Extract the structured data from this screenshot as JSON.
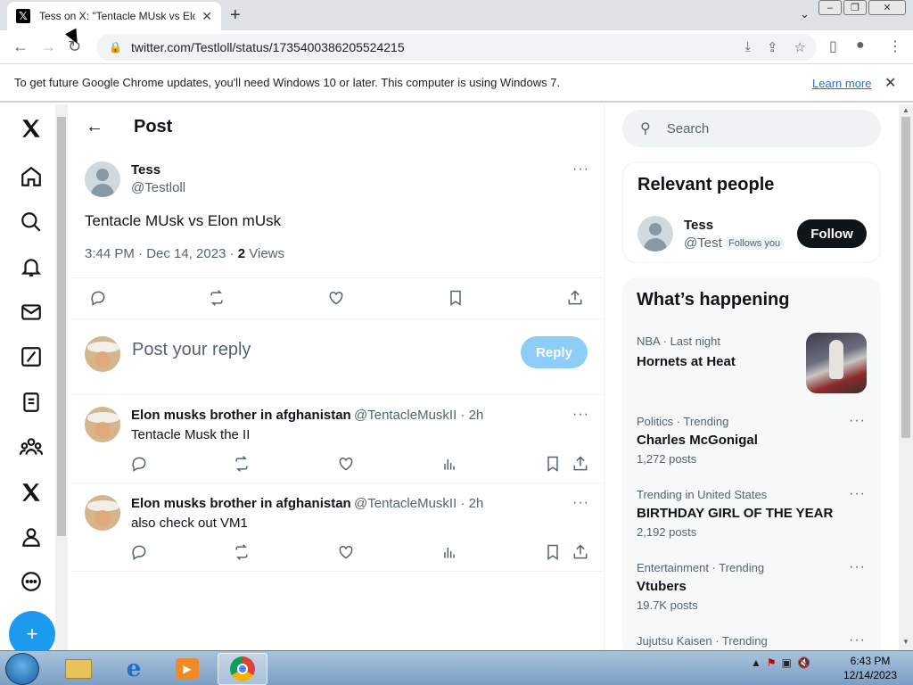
{
  "browser": {
    "tab_title": "Tess on X: \"Tentacle MUsk vs Elon",
    "url": "twitter.com/Testloll/status/1735400386205524215",
    "infobar_text": "To get future Google Chrome updates, you'll need Windows 10 or later. This computer is using Windows 7.",
    "infobar_link": "Learn more"
  },
  "header": {
    "title": "Post"
  },
  "tweet": {
    "name": "Tess",
    "handle": "@Testloll",
    "text": "Tentacle MUsk vs Elon mUsk",
    "time": "3:44 PM · Dec 14, 2023 · ",
    "views_count": "2",
    "views_label": " Views"
  },
  "reply_box": {
    "placeholder": "Post your reply",
    "button": "Reply"
  },
  "replies": [
    {
      "name": "Elon musks brother in afghanistan",
      "handle": "@TentacleMuskII · 2h",
      "text": "Tentacle Musk the II"
    },
    {
      "name": "Elon musks brother in afghanistan",
      "handle": "@TentacleMuskII · 2h",
      "text": "also check out VM1"
    }
  ],
  "search": {
    "placeholder": "Search"
  },
  "relevant": {
    "heading": "Relevant people",
    "name": "Tess",
    "handle": "@Test",
    "follows_you": "Follows you",
    "follow_btn": "Follow"
  },
  "happening": {
    "heading": "What’s happening",
    "trends": [
      {
        "category": "NBA · Last night",
        "title": "Hornets at Heat",
        "count": ""
      },
      {
        "category": "Politics · Trending",
        "title": "Charles McGonigal",
        "count": "1,272 posts"
      },
      {
        "category": "Trending in United States",
        "title": "BIRTHDAY GIRL OF THE YEAR",
        "count": "2,192 posts"
      },
      {
        "category": "Entertainment · Trending",
        "title": "Vtubers",
        "count": "19.7K posts"
      },
      {
        "category": "Jujutsu Kaisen · Trending",
        "title": "",
        "count": ""
      }
    ]
  },
  "taskbar": {
    "time": "6:43 PM",
    "date": "12/14/2023"
  }
}
